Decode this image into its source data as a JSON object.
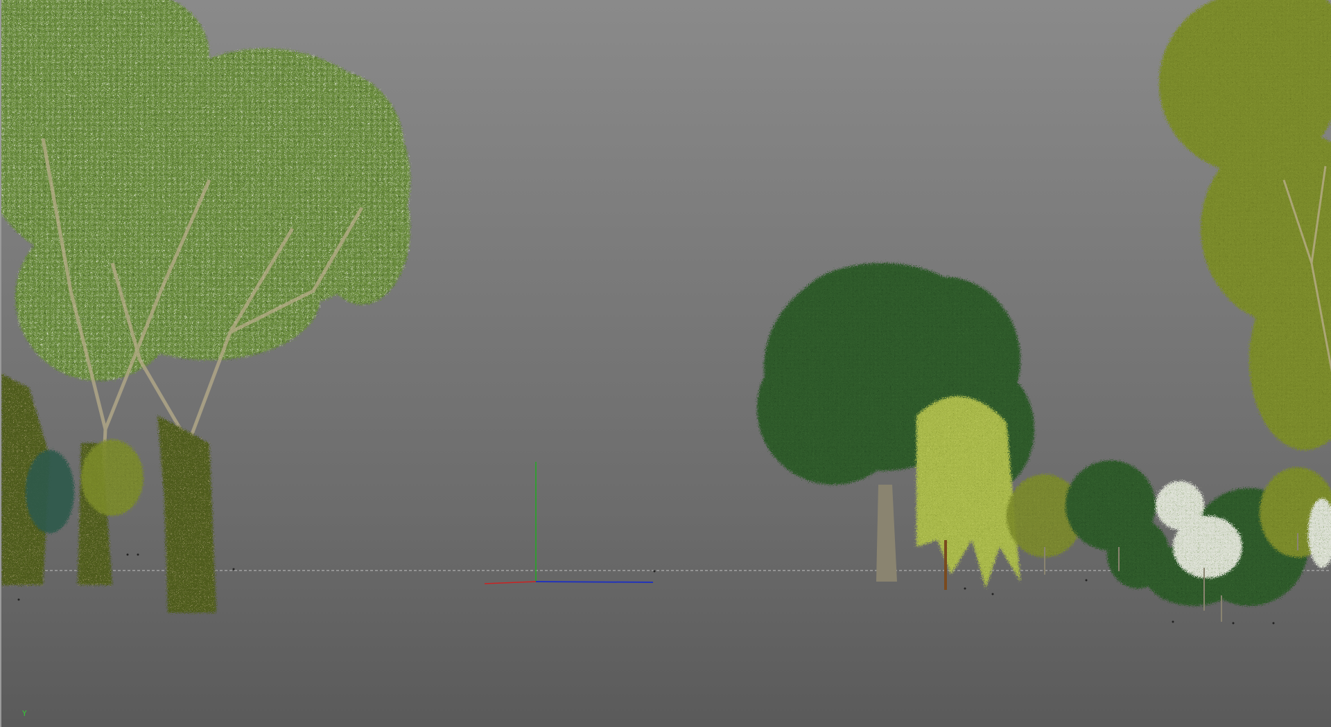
{
  "viewport": {
    "view_axis_label": "Y"
  },
  "colors": {
    "sky_top": "#8a8a8a",
    "ground": "#5a5a5a",
    "horizon_line": "#d8d8d8",
    "axis_y": "#22aa22",
    "axis_x": "#cc2222",
    "axis_z": "#2233bb",
    "foliage_light_green": "#6a8a3a",
    "foliage_dark_green": "#2f5a2a",
    "foliage_olive": "#7a8a2a",
    "foliage_willow": "#a8b84a",
    "blossom_white": "#e8ece0",
    "trunk_moss": "#4d5a1e",
    "branch_tan": "#b8ad8a"
  },
  "icons": {
    "world_origin_gizmo": "world-axis-gizmo-icon"
  }
}
